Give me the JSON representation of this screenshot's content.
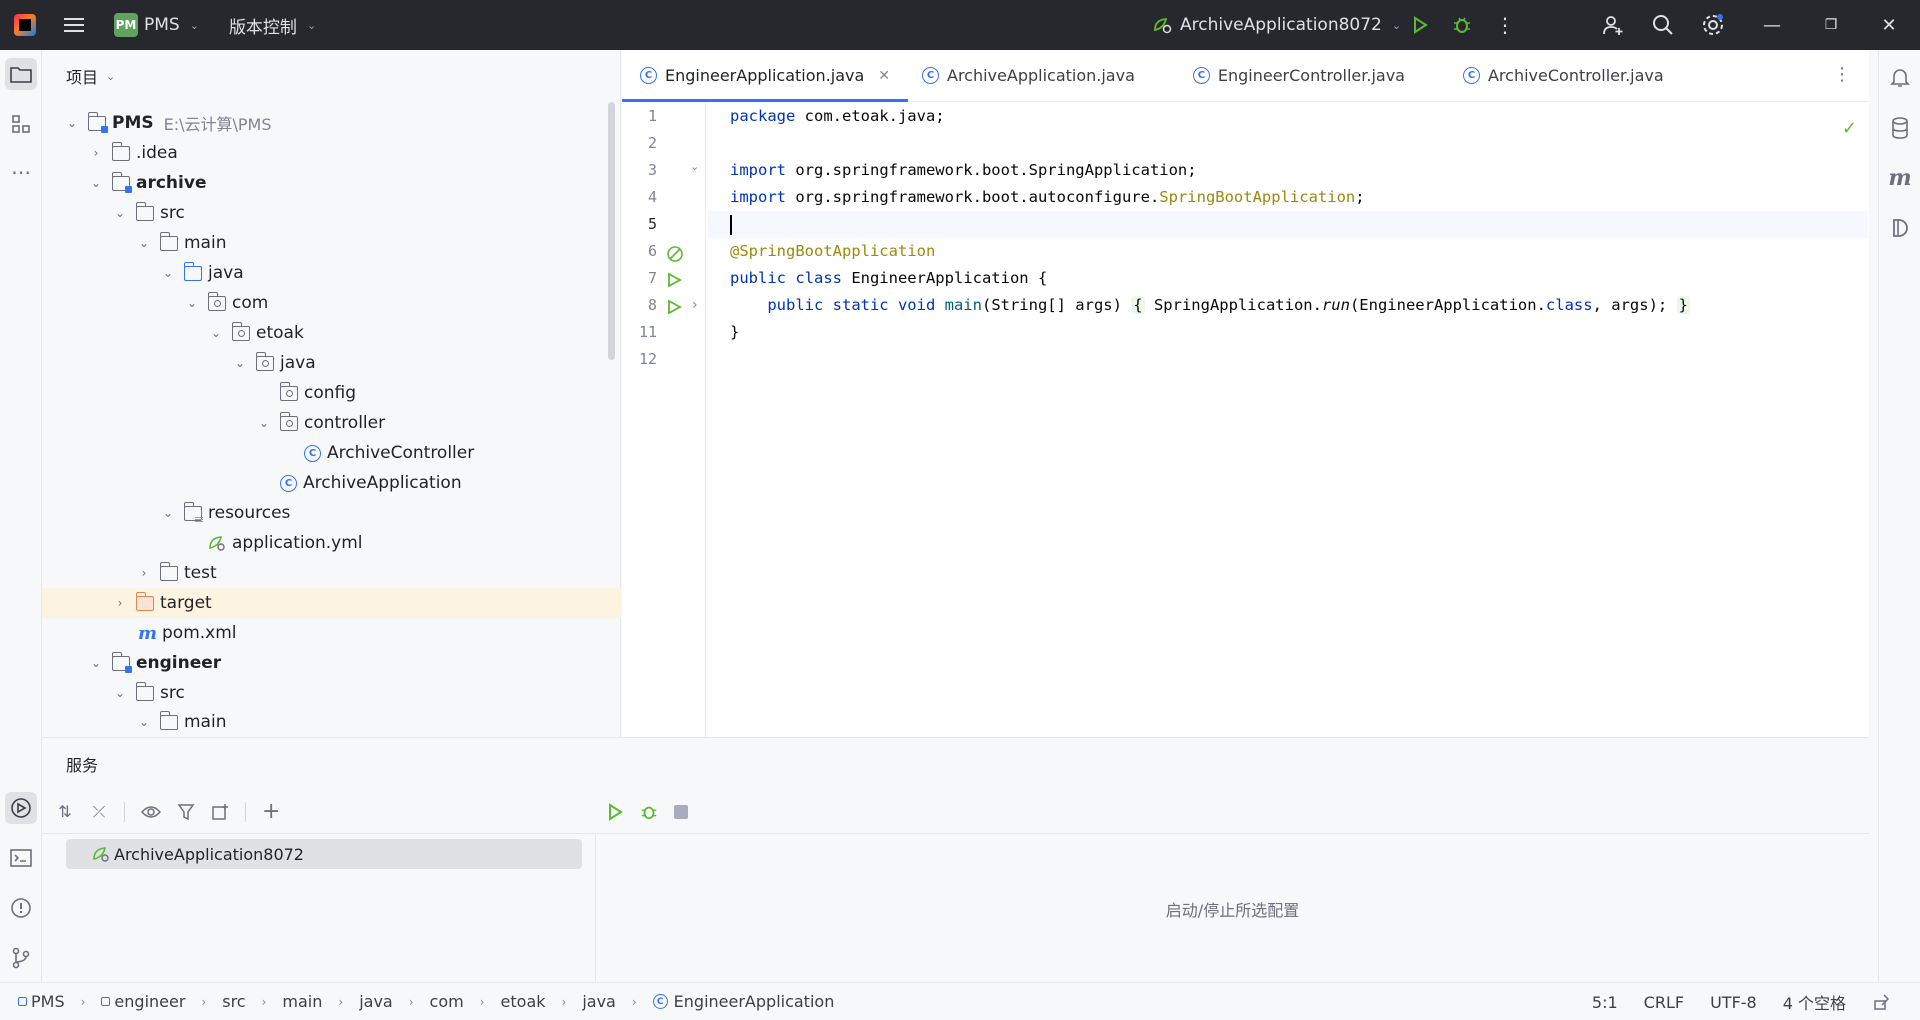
{
  "titlebar": {
    "project_badge": "PM",
    "project_name": "PMS",
    "vcs_label": "版本控制",
    "run_config": "ArchiveApplication8072"
  },
  "project_panel": {
    "title": "项目",
    "tree": [
      {
        "label": "PMS",
        "hint": "E:\\云计算\\PMS"
      },
      {
        "label": ".idea"
      },
      {
        "label": "archive"
      },
      {
        "label": "src"
      },
      {
        "label": "main"
      },
      {
        "label": "java"
      },
      {
        "label": "com"
      },
      {
        "label": "etoak"
      },
      {
        "label": "java"
      },
      {
        "label": "config"
      },
      {
        "label": "controller"
      },
      {
        "label": "ArchiveController"
      },
      {
        "label": "ArchiveApplication"
      },
      {
        "label": "resources"
      },
      {
        "label": "application.yml"
      },
      {
        "label": "test"
      },
      {
        "label": "target"
      },
      {
        "label": "pom.xml"
      },
      {
        "label": "engineer"
      },
      {
        "label": "src"
      },
      {
        "label": "main"
      }
    ]
  },
  "editor": {
    "tabs": [
      {
        "label": "EngineerApplication.java"
      },
      {
        "label": "ArchiveApplication.java"
      },
      {
        "label": "EngineerController.java"
      },
      {
        "label": "ArchiveController.java"
      }
    ],
    "line_numbers": [
      "1",
      "2",
      "3",
      "4",
      "5",
      "6",
      "7",
      "8",
      "11",
      "12"
    ],
    "code": {
      "l1_kw": "package",
      "l1_rest": " com.etoak.java;",
      "l3_kw": "import",
      "l3_rest": " org.springframework.boot.SpringApplication;",
      "l4_kw": "import",
      "l4_pre": " org.springframework.boot.autoconfigure.",
      "l4_ann": "SpringBootApplication",
      "l4_end": ";",
      "l6_ann": "@SpringBootApplication",
      "l7_kw": "public class",
      "l7_rest": " EngineerApplication {",
      "l8_indent": "    ",
      "l8_kw": "public static void",
      "l8_fn": " main",
      "l8_args": "(String[] args) ",
      "l8_open": "{",
      "l8_body1": " SpringApplication.",
      "l8_run": "run",
      "l8_body2": "(EngineerApplication.",
      "l8_class": "class",
      "l8_body3": ", args); ",
      "l8_close": "}",
      "l11": "}"
    }
  },
  "services": {
    "title": "服务",
    "item": "ArchiveApplication8072",
    "hint": "启动/停止所选配置"
  },
  "statusbar": {
    "breadcrumbs": [
      "PMS",
      "engineer",
      "src",
      "main",
      "java",
      "com",
      "etoak",
      "java",
      "EngineerApplication"
    ],
    "position": "5:1",
    "line_sep": "CRLF",
    "encoding": "UTF-8",
    "indent": "4 个空格"
  },
  "colors": {
    "accent": "#3574f0",
    "run_green": "#5fb832",
    "titlebar_bg": "#27282e"
  }
}
